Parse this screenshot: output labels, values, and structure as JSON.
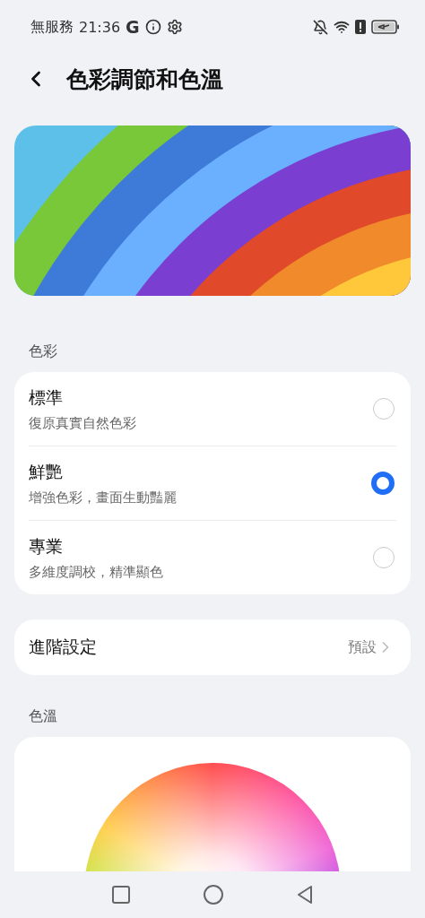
{
  "status_bar": {
    "carrier": "無服務",
    "time": "21:36",
    "app_letter": "G"
  },
  "header": {
    "title": "色彩調節和色溫"
  },
  "color_section": {
    "label": "色彩",
    "options": [
      {
        "title": "標準",
        "subtitle": "復原真實自然色彩",
        "selected": false
      },
      {
        "title": "鮮艷",
        "subtitle": "增強色彩，畫面生動豔麗",
        "selected": true
      },
      {
        "title": "專業",
        "subtitle": "多維度調校，精準顯色",
        "selected": false
      }
    ]
  },
  "advanced": {
    "label": "進階設定",
    "value": "預設"
  },
  "temperature_section": {
    "label": "色溫"
  }
}
